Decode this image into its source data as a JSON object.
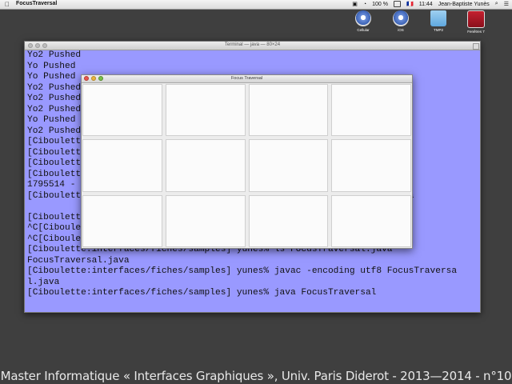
{
  "menubar": {
    "app_name": "FocusTraversal",
    "battery": "100 %",
    "flag": "🇫🇷",
    "clock": "11:44",
    "user": "Jean-Baptiste Yunès"
  },
  "desktop_icons": [
    {
      "label": "Cellular"
    },
    {
      "label": "iOS"
    },
    {
      "label": "TMP2"
    },
    {
      "label": "Fenêtres 7"
    }
  ],
  "terminal": {
    "title": "Terminal — java — 80×24",
    "lines": [
      "Yo2 Pushed",
      "Yo Pushed",
      "Yo Pushed",
      "Yo2 Pushed",
      "Yo2 Pushed",
      "Yo2 Pushed",
      "Yo Pushed",
      "Yo2 Pushed",
      "[Ciboulette                                                 n.java",
      "[Ciboulette",
      "[Ciboulette",
      "[Ciboulette",
      "1795514 -",
      "[Ciboulette                                                 ndoRedo.java",
      "",
      "[Ciboulette",
      "^C[Ciboule",
      "^C[Ciboule                                                 do.java",
      "[Ciboulette:interfaces/fiches/samples] yunes% ls FocusTraversal.java",
      "FocusTraversal.java",
      "[Ciboulette:interfaces/fiches/samples] yunes% javac -encoding utf8 FocusTraversa",
      "l.java",
      "[Ciboulette:interfaces/fiches/samples] yunes% java FocusTraversal"
    ]
  },
  "focus_window": {
    "title": "Focus Traversal",
    "rows": 3,
    "cols": 4
  },
  "caption": "Master Informatique « Interfaces Graphiques », Univ. Paris Diderot - 2013—2014 - n°10"
}
